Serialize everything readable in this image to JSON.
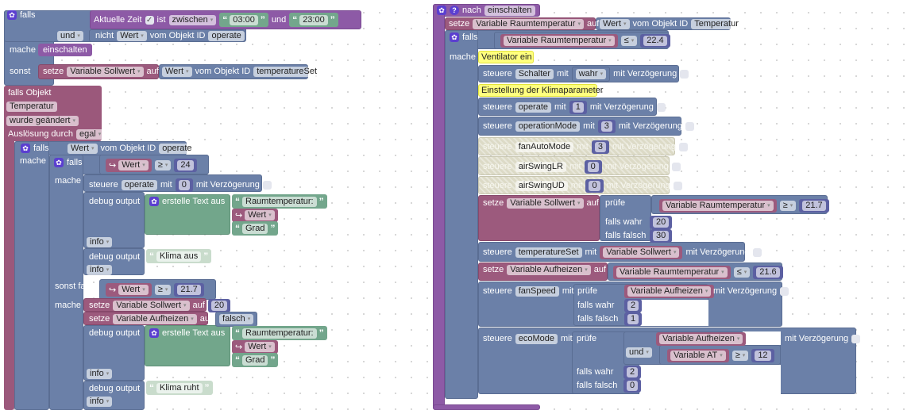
{
  "L": {
    "if1": [
      [
        "g"
      ],
      [
        "t",
        "falls"
      ]
    ],
    "time": [
      [
        "t",
        "Aktuelle Zeit"
      ],
      [
        "cb",
        true
      ],
      [
        "t",
        "ist"
      ],
      [
        "d",
        "zwischen"
      ],
      [
        "s",
        "03:00"
      ],
      [
        "t",
        "und"
      ],
      [
        "s",
        "23:00"
      ]
    ],
    "und": [
      [
        "d",
        "und"
      ]
    ],
    "nicht": [
      [
        "t",
        "nicht"
      ],
      [
        "d",
        "Wert"
      ],
      [
        "t",
        "vom Objekt ID"
      ],
      [
        "f",
        "operate"
      ]
    ],
    "mache1": [
      [
        "t",
        "mache"
      ]
    ],
    "einschalten": [
      [
        "p",
        "einschalten"
      ]
    ],
    "sonst": [
      [
        "t",
        "sonst"
      ]
    ],
    "setze0": [
      [
        "t",
        "setze"
      ],
      [
        "d",
        "Variable Sollwert"
      ],
      [
        "t",
        "auf"
      ]
    ],
    "wert0": [
      [
        "d",
        "Wert"
      ],
      [
        "t",
        "vom Objekt ID"
      ],
      [
        "f",
        "temperatureSet"
      ]
    ],
    "obj_title": [
      [
        "t",
        "falls Objekt"
      ]
    ],
    "obj_id": [
      [
        "f",
        "Temperatur"
      ]
    ],
    "obj_change": [
      [
        "d",
        "wurde geändert"
      ]
    ],
    "obj_trigger": [
      [
        "t",
        "Auslösung durch"
      ],
      [
        "d",
        "egal"
      ]
    ],
    "if2": [
      [
        "g"
      ],
      [
        "t",
        "falls"
      ]
    ],
    "if2cond": [
      [
        "d",
        "Wert"
      ],
      [
        "t",
        "vom Objekt ID"
      ],
      [
        "f",
        "operate"
      ]
    ],
    "mache2": [
      [
        "t",
        "mache"
      ]
    ],
    "if3": [
      [
        "g"
      ],
      [
        "t",
        "falls"
      ]
    ],
    "if3cond": [
      [
        "vr",
        "Wert"
      ],
      [
        "d",
        "≥"
      ],
      [
        "n",
        "24"
      ]
    ],
    "mache3": [
      [
        "t",
        "mache"
      ]
    ],
    "steuere1": [
      [
        "t",
        "steuere"
      ],
      [
        "f",
        "operate"
      ],
      [
        "t",
        "mit"
      ],
      [
        "n",
        "0"
      ],
      [
        "t",
        "mit Verzögerung"
      ],
      [
        "cb",
        false
      ]
    ],
    "debug1": [
      [
        "t",
        "debug output"
      ]
    ],
    "text1": [
      [
        "g"
      ],
      [
        "t",
        "erstelle Text aus"
      ]
    ],
    "str1": [
      [
        "s",
        "Raumtemperatur:"
      ]
    ],
    "var1": [
      [
        "vr",
        "Wert"
      ]
    ],
    "str2": [
      [
        "s",
        "Grad"
      ]
    ],
    "info1": [
      [
        "d",
        "info"
      ]
    ],
    "debug2": [
      [
        "t",
        "debug output"
      ]
    ],
    "str3": [
      [
        "sp",
        "Klima aus"
      ]
    ],
    "info2": [
      [
        "d",
        "info"
      ]
    ],
    "sonstfalls": [
      [
        "t",
        "sonst falls"
      ]
    ],
    "elifcond": [
      [
        "vr",
        "Wert"
      ],
      [
        "d",
        "≥"
      ],
      [
        "n",
        "21.7"
      ]
    ],
    "mache4": [
      [
        "t",
        "mache"
      ]
    ],
    "setze1": [
      [
        "t",
        "setze"
      ],
      [
        "d",
        "Variable Sollwert"
      ],
      [
        "t",
        "auf"
      ],
      [
        "n",
        "20"
      ]
    ],
    "setze2": [
      [
        "t",
        "setze"
      ],
      [
        "d",
        "Variable Aufheizen"
      ],
      [
        "t",
        "auf"
      ],
      [
        "b",
        "falsch"
      ]
    ],
    "debug3": [
      [
        "t",
        "debug output"
      ]
    ],
    "text2": [
      [
        "g"
      ],
      [
        "t",
        "erstelle Text aus"
      ]
    ],
    "str4": [
      [
        "s",
        "Raumtemperatur:"
      ]
    ],
    "var2": [
      [
        "vr",
        "Wert"
      ]
    ],
    "str5": [
      [
        "s",
        "Grad"
      ]
    ],
    "info3": [
      [
        "d",
        "info"
      ]
    ],
    "debug4": [
      [
        "t",
        "debug output"
      ]
    ],
    "str6": [
      [
        "sp",
        "Klima ruht"
      ]
    ],
    "info4": [
      [
        "d",
        "info"
      ]
    ]
  },
  "R": {
    "nach": [
      [
        "g"
      ],
      [
        "h"
      ],
      [
        "t",
        "nach"
      ],
      [
        "f",
        "einschalten"
      ]
    ],
    "setze": [
      [
        "t",
        "setze"
      ],
      [
        "d",
        "Variable Raumtemperatur"
      ],
      [
        "t",
        "auf"
      ]
    ],
    "wert": [
      [
        "d",
        "Wert"
      ],
      [
        "t",
        "vom Objekt ID"
      ],
      [
        "f",
        "Temperatur"
      ]
    ],
    "if": [
      [
        "g"
      ],
      [
        "t",
        "falls"
      ]
    ],
    "ifcond": [
      [
        "v",
        "Variable Raumtemperatur"
      ],
      [
        "d",
        "≤"
      ],
      [
        "n",
        "22.4"
      ]
    ],
    "mache": [
      [
        "t",
        "mache"
      ]
    ],
    "comment1": [
      [
        "t",
        "Ventilator ein"
      ]
    ],
    "st1": [
      [
        "t",
        "steuere"
      ],
      [
        "f",
        "Schalter"
      ],
      [
        "t",
        "mit"
      ],
      [
        "b",
        "wahr"
      ],
      [
        "t",
        "mit Verzögerung"
      ],
      [
        "cb",
        false
      ]
    ],
    "comment2": [
      [
        "t",
        "Einstellung der Klimaparameter"
      ]
    ],
    "st2": [
      [
        "t",
        "steuere"
      ],
      [
        "f",
        "operate"
      ],
      [
        "t",
        "mit"
      ],
      [
        "n",
        "1"
      ],
      [
        "t",
        "mit Verzögerung"
      ],
      [
        "cb",
        false
      ]
    ],
    "st3": [
      [
        "t",
        "steuere"
      ],
      [
        "f",
        "operationMode"
      ],
      [
        "t",
        "mit"
      ],
      [
        "n",
        "3"
      ],
      [
        "t",
        "mit Verzögerung"
      ],
      [
        "cb",
        false
      ]
    ],
    "st4": [
      [
        "t",
        "steuere"
      ],
      [
        "f",
        "fanAutoMode"
      ],
      [
        "t",
        "mit"
      ],
      [
        "n",
        "3"
      ],
      [
        "t",
        "mit Verzögerung"
      ],
      [
        "cb",
        false
      ]
    ],
    "st5": [
      [
        "t",
        "steuere"
      ],
      [
        "f",
        "airSwingLR"
      ],
      [
        "t",
        "mit"
      ],
      [
        "n",
        "0"
      ],
      [
        "t",
        "mit Verzögerung"
      ],
      [
        "cb",
        false
      ]
    ],
    "st6": [
      [
        "t",
        "steuere"
      ],
      [
        "f",
        "airSwingUD"
      ],
      [
        "t",
        "mit"
      ],
      [
        "n",
        "0"
      ],
      [
        "t",
        "mit Verzögerung"
      ],
      [
        "cb",
        false
      ]
    ],
    "setze2": [
      [
        "t",
        "setze"
      ],
      [
        "d",
        "Variable Sollwert"
      ],
      [
        "t",
        "auf"
      ]
    ],
    "pruefe1": [
      [
        "t",
        "prüfe"
      ]
    ],
    "cond1": [
      [
        "v",
        "Variable Raumtemperatur"
      ],
      [
        "d",
        "≥"
      ],
      [
        "n",
        "21.7"
      ]
    ],
    "wahr1": [
      [
        "t",
        "falls wahr"
      ]
    ],
    "wahr1v": [
      [
        "n",
        "20"
      ]
    ],
    "falsch1": [
      [
        "t",
        "falls falsch"
      ]
    ],
    "falsch1v": [
      [
        "n",
        "30"
      ]
    ],
    "st7": [
      [
        "t",
        "steuere"
      ],
      [
        "f",
        "temperatureSet"
      ],
      [
        "t",
        "mit"
      ],
      [
        "v",
        "Variable Sollwert"
      ],
      [
        "t",
        "mit Verzögerung"
      ],
      [
        "cb",
        false
      ]
    ],
    "setze3": [
      [
        "t",
        "setze"
      ],
      [
        "d",
        "Variable Aufheizen"
      ],
      [
        "t",
        "auf"
      ]
    ],
    "cond2": [
      [
        "v",
        "Variable Raumtemperatur"
      ],
      [
        "d",
        "≤"
      ],
      [
        "n",
        "21.6"
      ]
    ],
    "st8": [
      [
        "t",
        "steuere"
      ],
      [
        "f",
        "fanSpeed"
      ],
      [
        "t",
        "mit"
      ]
    ],
    "pruefe2": [
      [
        "t",
        "prüfe"
      ]
    ],
    "var3": [
      [
        "v",
        "Variable Aufheizen"
      ]
    ],
    "delay8": [
      [
        "t",
        "mit Verzögerung"
      ],
      [
        "cb",
        false
      ]
    ],
    "wahr2": [
      [
        "t",
        "falls wahr"
      ]
    ],
    "wahr2v": [
      [
        "n",
        "2"
      ]
    ],
    "falsch2": [
      [
        "t",
        "falls falsch"
      ]
    ],
    "falsch2v": [
      [
        "n",
        "1"
      ]
    ],
    "st9": [
      [
        "t",
        "steuere"
      ],
      [
        "f",
        "ecoMode"
      ],
      [
        "t",
        "mit"
      ]
    ],
    "pruefe3": [
      [
        "t",
        "prüfe"
      ]
    ],
    "var4": [
      [
        "v",
        "Variable Aufheizen"
      ]
    ],
    "und": [
      [
        "d",
        "und"
      ]
    ],
    "cond3": [
      [
        "v",
        "Variable AT"
      ],
      [
        "d",
        "≥"
      ],
      [
        "n",
        "12"
      ]
    ],
    "delay9": [
      [
        "t",
        "mit Verzögerung"
      ],
      [
        "cb",
        false
      ]
    ],
    "wahr3": [
      [
        "t",
        "falls wahr"
      ]
    ],
    "wahr3v": [
      [
        "n",
        "2"
      ]
    ],
    "falsch3": [
      [
        "t",
        "falls falsch"
      ]
    ],
    "falsch3v": [
      [
        "n",
        "0"
      ]
    ]
  },
  "colors": {
    "logic": "#6b80a8",
    "event": "#8d5aa6",
    "variable": "#9c5a7d",
    "text": "#72a68b",
    "math": "#5c60a2",
    "comment": "#ffff7e"
  }
}
